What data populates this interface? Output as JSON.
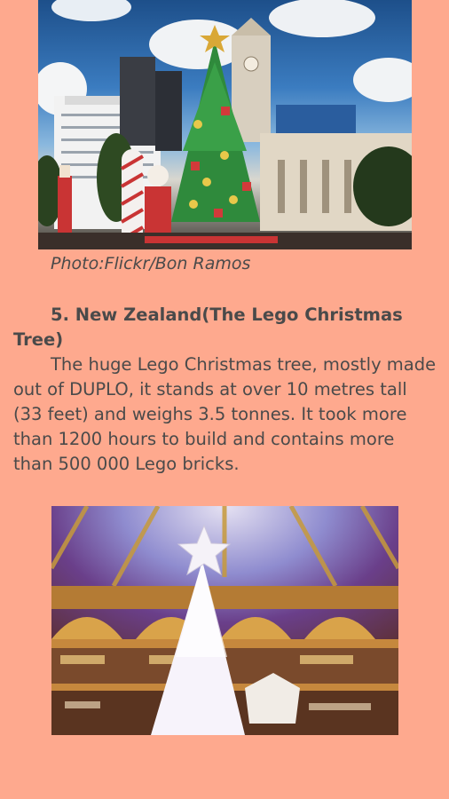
{
  "article": {
    "photo1": {
      "alt_icon": "lego-christmas-tree-photo",
      "caption": "Photo:Flickr/Bon Ramos"
    },
    "section": {
      "heading": "5. New Zealand(The Lego Christmas Tree)",
      "body": "The huge Lego Christmas tree, mostly made out of DUPLO, it stands at over 10 metres tall (33 feet) and weighs 3.5 tonnes. It took more than 1200 hours to build and contains more than 500 000 Lego bricks."
    },
    "photo2": {
      "alt_icon": "galeries-lafayette-christmas-tree-photo"
    }
  },
  "colors": {
    "background": "#fea98e",
    "text": "#4a4a4a"
  }
}
